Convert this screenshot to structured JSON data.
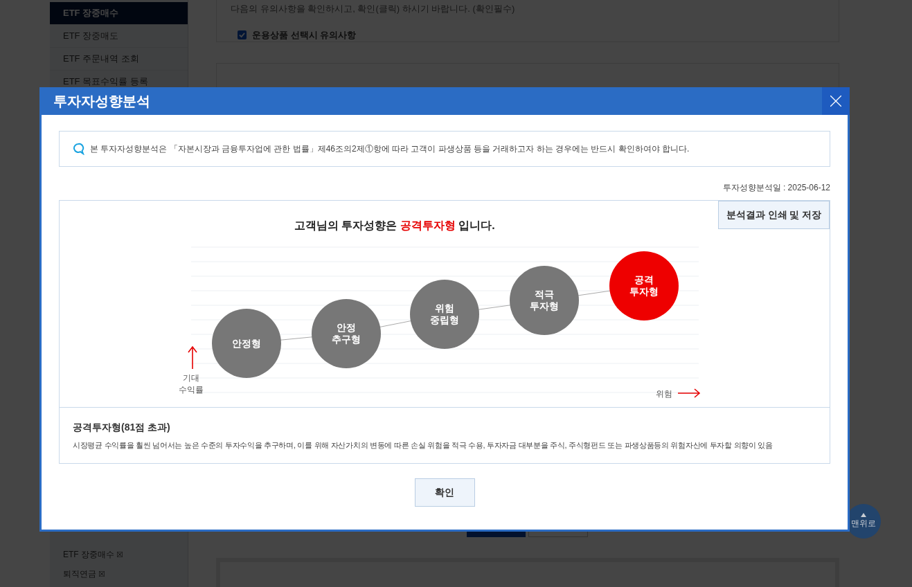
{
  "sidebar": {
    "items": [
      {
        "label": "ETF 장중매수",
        "selected": true
      },
      {
        "label": "ETF 장중매도",
        "selected": false
      },
      {
        "label": "ETF 주문내역 조회",
        "selected": false
      },
      {
        "label": "ETF 목표수익률 등록",
        "selected": false
      }
    ],
    "recent": [
      {
        "label": "ETF 장중매수",
        "remove": "☒"
      },
      {
        "label": "퇴직연금",
        "remove": "☒"
      }
    ]
  },
  "notice_panel": {
    "text": "다음의 유의사항을 확인하시고, 확인(클릭) 하시기 바랍니다. (확인필수)",
    "checkbox": {
      "label": "운용상품 선택시 유의사항",
      "checked": true
    }
  },
  "scroll_top": {
    "label": "맨위로"
  },
  "dialog": {
    "title": "투자자성향분석",
    "info": "본 투자자성향분석은 「자본시장과 금융투자업에 관한 법률」제46조의2제①항에 따라 고객이 파생상품 등을 거래하고자 하는 경우에는 반드시 확인하여야 합니다.",
    "date": "투자성향분석일 : 2025-06-12",
    "print_button": "분석결과 인쇄 및 저장",
    "headline": {
      "prefix": "고객님의 투자성향은",
      "result": "공격투자형",
      "suffix": "입니다."
    },
    "levels": [
      {
        "label": "안정형",
        "selected": false
      },
      {
        "label": "안정\n추구형",
        "selected": false
      },
      {
        "label": "위험\n중립형",
        "selected": false
      },
      {
        "label": "적극\n투자형",
        "selected": false
      },
      {
        "label": "공격\n투자형",
        "selected": true
      }
    ],
    "y_axis_label": "기대\n수익률",
    "x_axis_label": "위험",
    "result_title": "공격투자형(81점 초과)",
    "result_text": "시장평균 수익률을 훨씬 넘어서는 높은 수준의 투자수익을 추구하며, 이를 위해 자산가치의 변동에 따른 손실 위험을 적극 수용, 투자자금 대부분을 주식, 주식형펀드 또는 파생상품등의 위험자산에 투자할 의향이 있음",
    "confirm_button": "확인"
  }
}
